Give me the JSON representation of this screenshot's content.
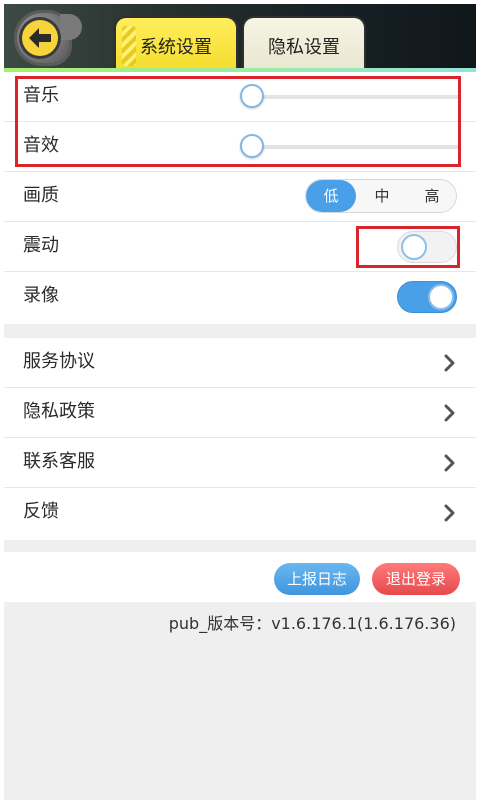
{
  "tabs": [
    {
      "label": "系统设置",
      "active": true
    },
    {
      "label": "隐私设置",
      "active": false
    }
  ],
  "audio": {
    "music_label": "音乐",
    "music_level": 0,
    "sfx_label": "音效",
    "sfx_level": 0
  },
  "quality": {
    "label": "画质",
    "options": [
      "低",
      "中",
      "高"
    ],
    "selected": "低"
  },
  "vibration": {
    "label": "震动",
    "on": false
  },
  "recording": {
    "label": "录像",
    "on": true
  },
  "links": [
    {
      "label": "服务协议"
    },
    {
      "label": "隐私政策"
    },
    {
      "label": "联系客服"
    },
    {
      "label": "反馈"
    }
  ],
  "actions": {
    "report_log": "上报日志",
    "logout": "退出登录"
  },
  "version_text": "pub_版本号：v1.6.176.1(1.6.176.36)",
  "colors": {
    "accent": "#4aa0e8",
    "logout": "#e6494b",
    "highlight": "#d9242b",
    "tab_active": "#f4dc2c"
  },
  "icons": {
    "back": "back-arrow-icon",
    "chevron": "chevron-right-icon"
  }
}
